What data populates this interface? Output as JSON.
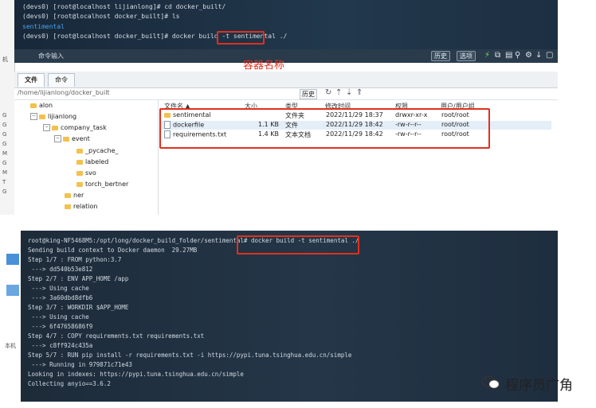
{
  "top": {
    "terminal_lines": [
      "(devs0) [root@localhost lijianlong]# cd docker_built/",
      "(devs0) [root@localhost docker_built]# ls",
      "sentimental",
      "(devs0) [root@localhost docker_built]# docker build -t ",
      "sentimental",
      " ./"
    ],
    "cmd_placeholder": "命令输入",
    "cmd_buttons": [
      "历史",
      "选项"
    ],
    "annotation": "容器名称",
    "tabs": [
      "文件",
      "命令"
    ],
    "path": "/home/lijianlong/docker_built",
    "history_btn": "历史",
    "tree": [
      {
        "label": "alon",
        "depth": 1,
        "expand": ""
      },
      {
        "label": "lijianlong",
        "depth": 1,
        "expand": "−"
      },
      {
        "label": "company_task",
        "depth": 2,
        "expand": "−"
      },
      {
        "label": "event",
        "depth": 3,
        "expand": "−"
      },
      {
        "label": "_pycache_",
        "depth": 4,
        "expand": ""
      },
      {
        "label": "labeled",
        "depth": 4,
        "expand": ""
      },
      {
        "label": "svo",
        "depth": 4,
        "expand": ""
      },
      {
        "label": "torch_bertner",
        "depth": 4,
        "expand": ""
      },
      {
        "label": "ner",
        "depth": 3,
        "expand": ""
      },
      {
        "label": "relation",
        "depth": 3,
        "expand": ""
      }
    ],
    "columns": [
      "文件名 ▲",
      "大小",
      "类型",
      "修改时间",
      "权限",
      "用户/用户组"
    ],
    "files": [
      {
        "name": "sentimental",
        "size": "",
        "type": "文件夹",
        "mtime": "2022/11/29 18:37",
        "perm": "drwxr-xr-x",
        "owner": "root/root",
        "kind": "folder"
      },
      {
        "name": "dockerfile",
        "size": "1.1 KB",
        "type": "文件",
        "mtime": "2022/11/29 18:42",
        "perm": "-rw-r--r--",
        "owner": "root/root",
        "kind": "file"
      },
      {
        "name": "requirements.txt",
        "size": "1.4 KB",
        "type": "文本文档",
        "mtime": "2022/11/29 18:42",
        "perm": "-rw-r--r--",
        "owner": "root/root",
        "kind": "txt"
      }
    ],
    "left_strip": [
      "机",
      "G",
      "G",
      "G",
      "G",
      "M",
      "G",
      "M",
      "T",
      "G"
    ]
  },
  "bottom": {
    "prompt": "root@king-NF5468M5:/opt/long/docker_build_folder/sentimental# ",
    "command": "docker build -t sentimental ./",
    "lines": [
      "Sending build context to Docker daemon  29.27MB",
      "Step 1/7 : FROM python:3.7",
      " ---> dd540b53e812",
      "Step 2/7 : ENV APP_HOME /app",
      " ---> Using cache",
      " ---> 3a60dbd8dfb6",
      "Step 3/7 : WORKDIR $APP_HOME",
      " ---> Using cache",
      " ---> 6f47658686f9",
      "Step 4/7 : COPY requirements.txt requirements.txt",
      " ---> c8ff924c435a",
      "Step 5/7 : RUN pip install -r requirements.txt -i https://pypi.tuna.tsinghua.edu.cn/simple",
      " ---> Running in 979871c71e43",
      "Looking in indexes: https://pypi.tuna.tsinghua.edu.cn/simple",
      "Collecting anyio==3.6.2"
    ],
    "left_strip": [
      "本机"
    ]
  },
  "watermark": "程序员广角",
  "colors": {
    "annotation": "#e0301e",
    "terminal_bg": "#1f2d3b",
    "folder": "#f2c14e"
  }
}
